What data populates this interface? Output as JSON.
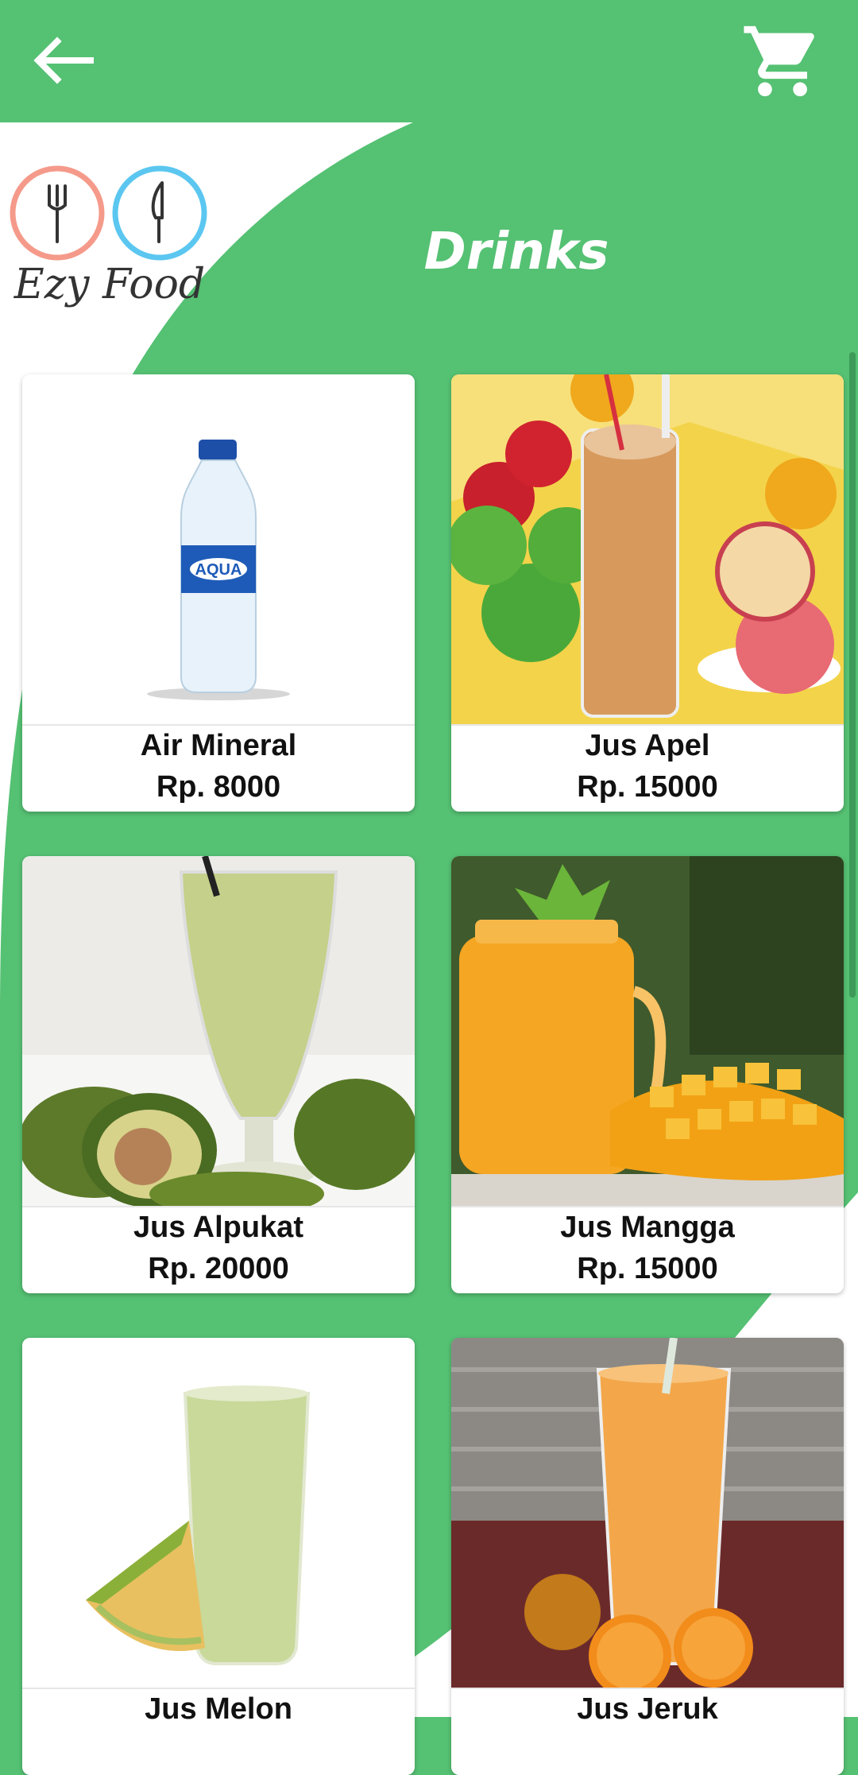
{
  "header": {
    "back_icon": "arrow-left-icon",
    "cart_icon": "shopping-cart-icon"
  },
  "logo": {
    "text": "Ezy Food",
    "fork_ring_color": "#f59a8a",
    "knife_ring_color": "#5bc7f0"
  },
  "title": "Drinks",
  "colors": {
    "brand_green": "#55c173",
    "card_bg": "#ffffff"
  },
  "menu": [
    {
      "name": "Air Mineral",
      "price": "Rp. 8000"
    },
    {
      "name": "Jus Apel",
      "price": "Rp. 15000"
    },
    {
      "name": "Jus Alpukat",
      "price": "Rp. 20000"
    },
    {
      "name": "Jus Mangga",
      "price": "Rp. 15000"
    },
    {
      "name": "Jus Melon",
      "price": ""
    },
    {
      "name": "Jus Jeruk",
      "price": ""
    }
  ]
}
